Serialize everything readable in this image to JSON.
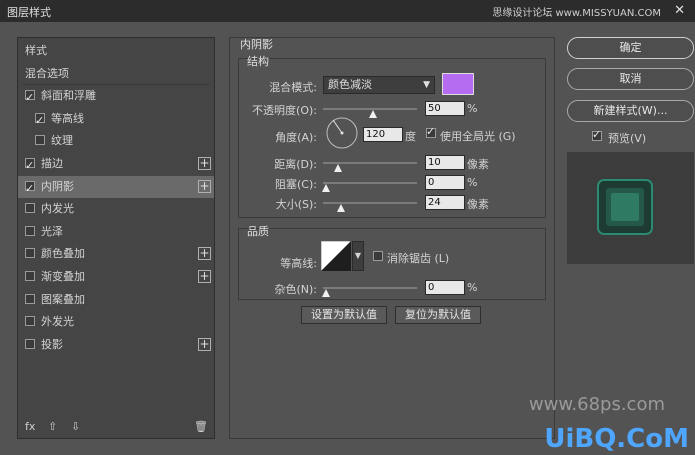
{
  "window": {
    "title": "图层样式",
    "watermark": "思缘设计论坛 www.MISSYUAN.COM",
    "close": "✕"
  },
  "left_panel": {
    "items": [
      {
        "label": "样式",
        "checkbox": false,
        "checked": false,
        "plus": false,
        "indent": false,
        "selected": false
      },
      {
        "label": "混合选项",
        "checkbox": false,
        "checked": false,
        "plus": false,
        "indent": false,
        "selected": false
      },
      {
        "label": "斜面和浮雕",
        "checkbox": true,
        "checked": true,
        "plus": false,
        "indent": false,
        "selected": false
      },
      {
        "label": "等高线",
        "checkbox": true,
        "checked": true,
        "plus": false,
        "indent": true,
        "selected": false
      },
      {
        "label": "纹理",
        "checkbox": true,
        "checked": false,
        "plus": false,
        "indent": true,
        "selected": false
      },
      {
        "label": "描边",
        "checkbox": true,
        "checked": true,
        "plus": true,
        "indent": false,
        "selected": false
      },
      {
        "label": "内阴影",
        "checkbox": true,
        "checked": true,
        "plus": true,
        "indent": false,
        "selected": true
      },
      {
        "label": "内发光",
        "checkbox": true,
        "checked": false,
        "plus": false,
        "indent": false,
        "selected": false
      },
      {
        "label": "光泽",
        "checkbox": true,
        "checked": false,
        "plus": false,
        "indent": false,
        "selected": false
      },
      {
        "label": "颜色叠加",
        "checkbox": true,
        "checked": false,
        "plus": true,
        "indent": false,
        "selected": false
      },
      {
        "label": "渐变叠加",
        "checkbox": true,
        "checked": false,
        "plus": true,
        "indent": false,
        "selected": false
      },
      {
        "label": "图案叠加",
        "checkbox": true,
        "checked": false,
        "plus": false,
        "indent": false,
        "selected": false
      },
      {
        "label": "外发光",
        "checkbox": true,
        "checked": false,
        "plus": false,
        "indent": false,
        "selected": false
      },
      {
        "label": "投影",
        "checkbox": true,
        "checked": false,
        "plus": true,
        "indent": false,
        "selected": false
      }
    ],
    "footer": {
      "fx": "fx",
      "up": "⇧",
      "down": "⇩",
      "trash": "🗑"
    }
  },
  "inner_shadow": {
    "title": "内阴影",
    "structure": {
      "title": "结构",
      "blend_mode_label": "混合模式:",
      "blend_mode_value": "颜色减淡",
      "color": "#b56cf0",
      "opacity_label": "不透明度(O):",
      "opacity_value": "50",
      "opacity_unit": "%",
      "angle_label": "角度(A):",
      "angle_value": "120",
      "angle_unit": "度",
      "global_light_label": "使用全局光 (G)",
      "distance_label": "距离(D):",
      "distance_value": "10",
      "distance_unit": "像素",
      "choke_label": "阻塞(C):",
      "choke_value": "0",
      "choke_unit": "%",
      "size_label": "大小(S):",
      "size_value": "24",
      "size_unit": "像素"
    },
    "quality": {
      "title": "品质",
      "contour_label": "等高线:",
      "antialias_label": "消除锯齿 (L)",
      "noise_label": "杂色(N):",
      "noise_value": "0",
      "noise_unit": "%"
    },
    "make_default": "设置为默认值",
    "reset_default": "复位为默认值"
  },
  "right_panel": {
    "ok": "确定",
    "cancel": "取消",
    "new_style": "新建样式(W)...",
    "preview_label": "预览(V)"
  },
  "watermarks": {
    "site": "www.68ps.com",
    "brand": "UiBQ.CoM"
  }
}
